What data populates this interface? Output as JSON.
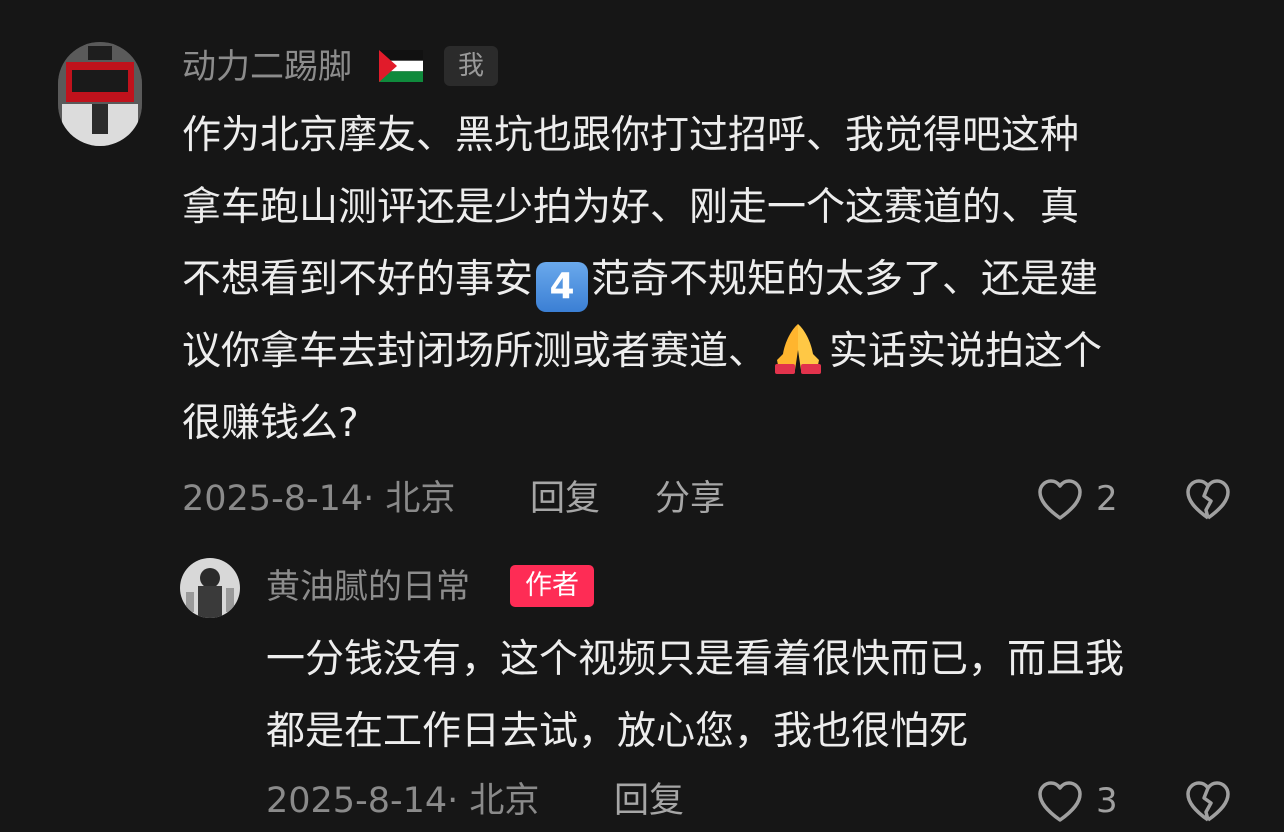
{
  "comments": [
    {
      "username": "动力二踢脚",
      "user_badge": "我",
      "flag_icon": "palestine-flag-icon",
      "text_lines": [
        "作为北京摩友、黑坑也跟你打过招呼、我觉得吧这种",
        "拿车跑山测评还是少拍为好、刚走一个这赛道的、真",
        "不想看到不好的事安",
        "范奇不规矩的太多了、还是建",
        "议你拿车去封闭场所测或者赛道、",
        "实话实说拍这个",
        "很赚钱么?"
      ],
      "keycap_emoji": "4",
      "date_location": "2025-8-14· 北京",
      "reply_label": "回复",
      "share_label": "分享",
      "like_count": "2"
    },
    {
      "username": "黄油腻的日常",
      "author_badge": "作者",
      "text_lines": [
        "一分钱没有，这个视频只是看着很快而已，而且我",
        "都是在工作日去试，放心您，我也很怕死"
      ],
      "date_location": "2025-8-14· 北京",
      "reply_label": "回复",
      "like_count": "3"
    }
  ],
  "colors": {
    "background": "#161616",
    "author_badge": "#fe2c55",
    "meta_text": "#8a8a8a",
    "body_text": "#ededed"
  }
}
